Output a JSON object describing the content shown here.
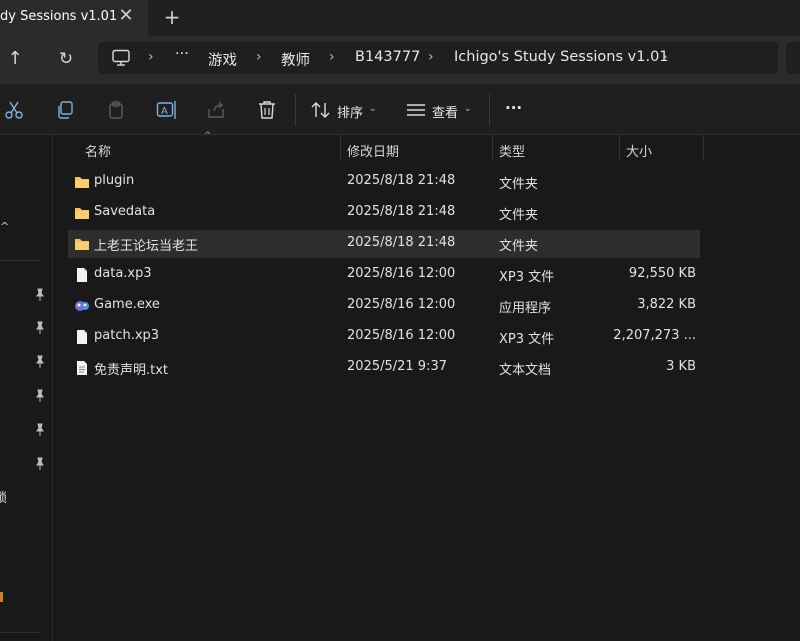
{
  "tab": {
    "title": "dy Sessions v1.01",
    "close_glyph": "✕",
    "new_glyph": "+"
  },
  "nav": {
    "up_glyph": "↑",
    "refresh_glyph": "↻"
  },
  "address": {
    "more_glyph": "···",
    "sep_glyph": "›",
    "crumbs": [
      "游戏",
      "教师",
      "B143777",
      "Ichigo's Study Sessions v1.01"
    ]
  },
  "toolbar": {
    "sort_label": "排序",
    "view_label": "查看",
    "more_glyph": "···",
    "chevron_glyph": "⌄"
  },
  "sidebar": {
    "pin_glyph": "📌",
    "fragments": [
      "^",
      "锁"
    ]
  },
  "columns": {
    "name": "名称",
    "modified": "修改日期",
    "type": "类型",
    "size": "大小",
    "sort_glyph": "^"
  },
  "files": [
    {
      "name": "plugin",
      "modified": "2025/8/18 21:48",
      "type": "文件夹",
      "size": "",
      "icon": "folder-icon"
    },
    {
      "name": "Savedata",
      "modified": "2025/8/18 21:48",
      "type": "文件夹",
      "size": "",
      "icon": "folder-icon"
    },
    {
      "name": "上老王论坛当老王",
      "modified": "2025/8/18 21:48",
      "type": "文件夹",
      "size": "",
      "icon": "folder-icon"
    },
    {
      "name": "data.xp3",
      "modified": "2025/8/16 12:00",
      "type": "XP3 文件",
      "size": "92,550 KB",
      "icon": "file-icon"
    },
    {
      "name": "Game.exe",
      "modified": "2025/8/16 12:00",
      "type": "应用程序",
      "size": "3,822 KB",
      "icon": "app-icon"
    },
    {
      "name": "patch.xp3",
      "modified": "2025/8/16 12:00",
      "type": "XP3 文件",
      "size": "2,207,273 ...",
      "icon": "file-icon"
    },
    {
      "name": "免责声明.txt",
      "modified": "2025/5/21 9:37",
      "type": "文本文档",
      "size": "3 KB",
      "icon": "text-file-icon"
    }
  ],
  "colors": {
    "folder": "#f4c25a",
    "selected_row": "#2d2d2d",
    "background": "#191919"
  }
}
